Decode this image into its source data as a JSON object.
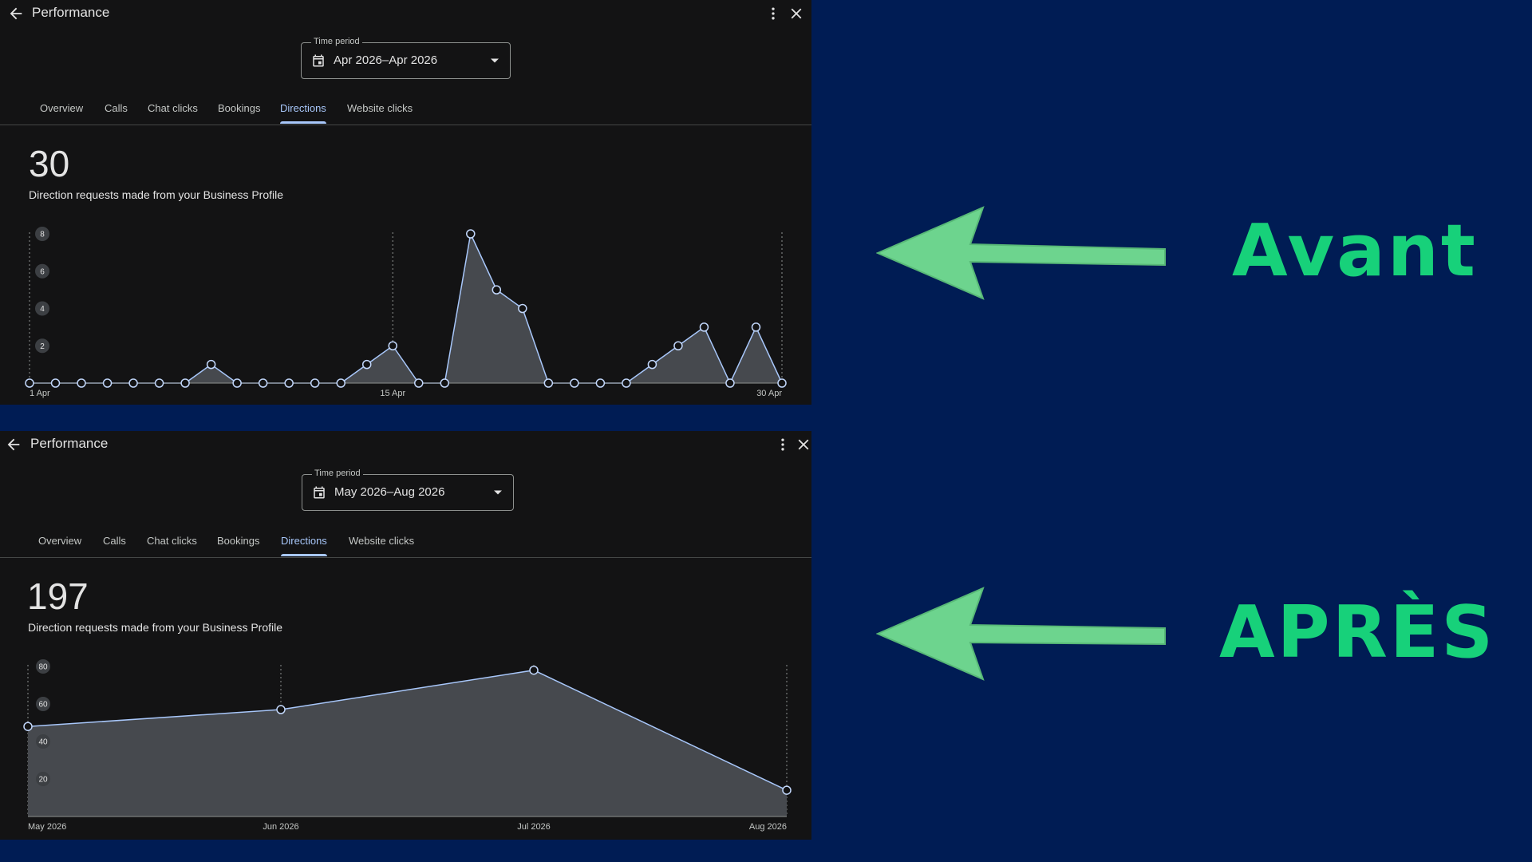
{
  "panels": [
    {
      "header": {
        "title": "Performance"
      },
      "time_period": {
        "label": "Time period",
        "value": "Apr 2026–Apr 2026"
      },
      "tabs": [
        "Overview",
        "Calls",
        "Chat clicks",
        "Bookings",
        "Directions",
        "Website clicks"
      ],
      "active_tab": "Directions",
      "metric": {
        "value": "30",
        "description": "Direction requests made from your Business Profile"
      }
    },
    {
      "header": {
        "title": "Performance"
      },
      "time_period": {
        "label": "Time period",
        "value": "May 2026–Aug 2026"
      },
      "tabs": [
        "Overview",
        "Calls",
        "Chat clicks",
        "Bookings",
        "Directions",
        "Website clicks"
      ],
      "active_tab": "Directions",
      "metric": {
        "value": "197",
        "description": "Direction requests made from your Business Profile"
      }
    }
  ],
  "labels": {
    "before": "Avant",
    "after": "APRÈS"
  },
  "colors": {
    "background": "#001c54",
    "panel": "#131314",
    "accent": "#a8c7fa",
    "arrow": "#6dd48e",
    "label": "#17d17a"
  },
  "chart_data": [
    {
      "type": "area",
      "x": [
        "1 Apr",
        "2 Apr",
        "3 Apr",
        "4 Apr",
        "5 Apr",
        "6 Apr",
        "7 Apr",
        "8 Apr",
        "9 Apr",
        "10 Apr",
        "11 Apr",
        "12 Apr",
        "13 Apr",
        "14 Apr",
        "15 Apr",
        "16 Apr",
        "17 Apr",
        "18 Apr",
        "19 Apr",
        "20 Apr",
        "21 Apr",
        "22 Apr",
        "23 Apr",
        "24 Apr",
        "25 Apr",
        "26 Apr",
        "27 Apr",
        "28 Apr",
        "29 Apr",
        "30 Apr"
      ],
      "values": [
        0,
        0,
        0,
        0,
        0,
        0,
        0,
        1,
        0,
        0,
        0,
        0,
        0,
        1,
        2,
        0,
        0,
        8,
        5,
        4,
        0,
        0,
        0,
        0,
        1,
        2,
        3,
        0,
        3,
        0
      ],
      "x_tick_labels": [
        "1 Apr",
        "15 Apr",
        "30 Apr"
      ],
      "y_ticks": [
        2,
        4,
        6,
        8
      ],
      "ylim": [
        0,
        8
      ]
    },
    {
      "type": "area",
      "x": [
        "May 2026",
        "Jun 2026",
        "Jul 2026",
        "Aug 2026"
      ],
      "values": [
        48,
        57,
        78,
        14
      ],
      "x_tick_labels": [
        "May 2026",
        "Jun 2026",
        "Jul 2026",
        "Aug 2026"
      ],
      "y_ticks": [
        20,
        40,
        60,
        80
      ],
      "ylim": [
        0,
        80
      ]
    }
  ]
}
